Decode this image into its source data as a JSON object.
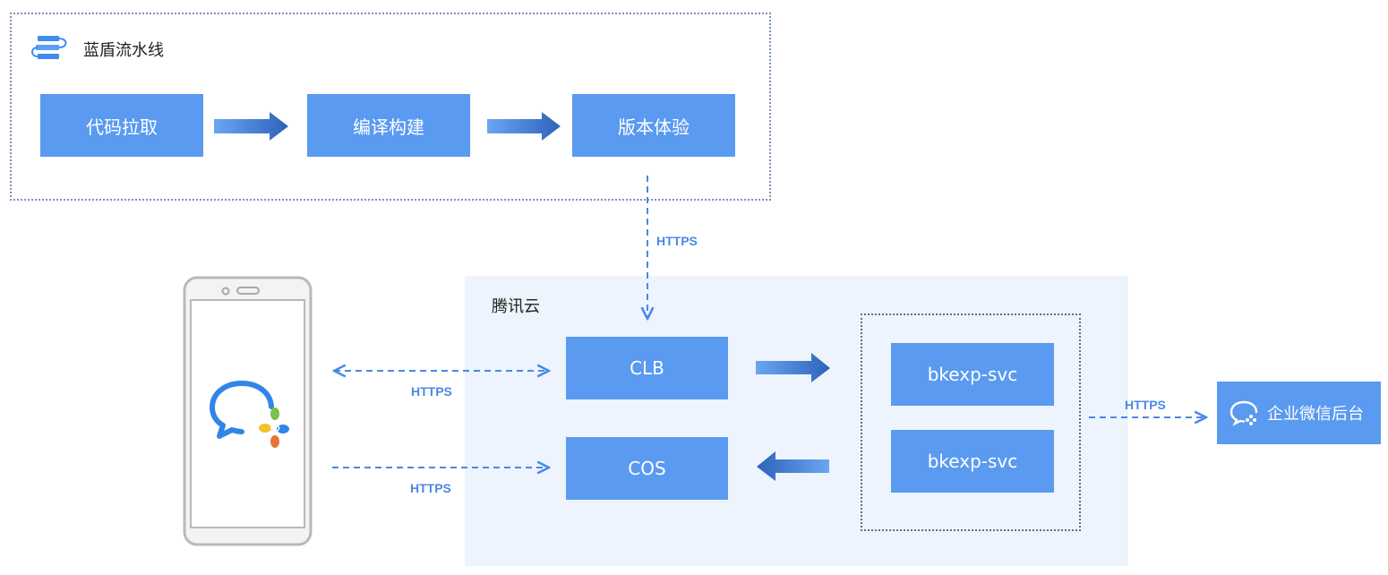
{
  "pipeline": {
    "title": "蓝盾流水线",
    "icon": "pipeline-stack-icon",
    "steps": [
      "代码拉取",
      "编译构建",
      "版本体验"
    ]
  },
  "cloud": {
    "title": "腾讯云",
    "clb": "CLB",
    "cos": "COS"
  },
  "services": [
    "bkexp-svc",
    "bkexp-svc"
  ],
  "wecom_backend": {
    "label": "企业微信后台",
    "icon": "wecom-chat-icon"
  },
  "phone": {
    "app_icon": "wecom-app-icon"
  },
  "links": {
    "pipeline_to_clb": "HTTPS",
    "phone_clb": "HTTPS",
    "phone_cos": "HTTPS",
    "svc_to_wecom": "HTTPS"
  },
  "colors": {
    "box": "#5a9af0",
    "arrow": "#3f74cc",
    "dashed": "#4a88e8",
    "cloud_bg": "#edf4fd"
  }
}
